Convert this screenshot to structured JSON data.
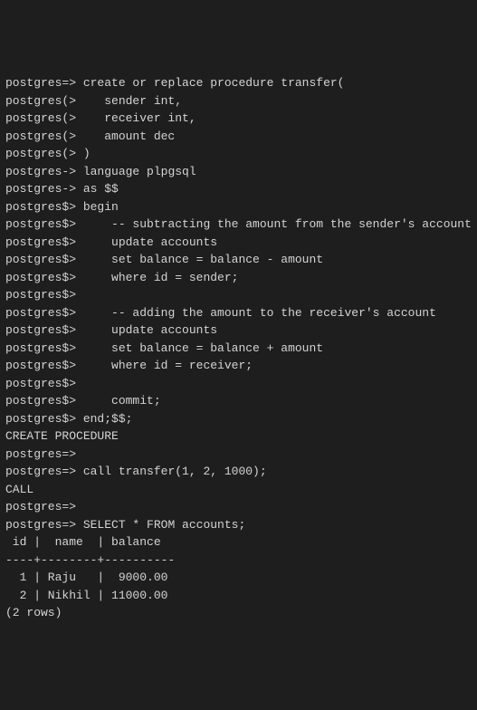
{
  "lines": [
    {
      "prompt": "postgres=> ",
      "text": "create or replace procedure transfer("
    },
    {
      "prompt": "postgres(>    ",
      "text": "sender int,"
    },
    {
      "prompt": "postgres(>    ",
      "text": "receiver int,"
    },
    {
      "prompt": "postgres(>    ",
      "text": "amount dec"
    },
    {
      "prompt": "postgres(> ",
      "text": ")"
    },
    {
      "prompt": "postgres-> ",
      "text": "language plpgsql"
    },
    {
      "prompt": "postgres-> ",
      "text": "as $$"
    },
    {
      "prompt": "postgres$> ",
      "text": "begin"
    },
    {
      "prompt": "postgres$>     ",
      "text": "-- subtracting the amount from the sender's account"
    },
    {
      "prompt": "postgres$>     ",
      "text": "update accounts"
    },
    {
      "prompt": "postgres$>     ",
      "text": "set balance = balance - amount"
    },
    {
      "prompt": "postgres$>     ",
      "text": "where id = sender;"
    },
    {
      "prompt": "postgres$>",
      "text": ""
    },
    {
      "prompt": "postgres$>     ",
      "text": "-- adding the amount to the receiver's account"
    },
    {
      "prompt": "postgres$>     ",
      "text": "update accounts"
    },
    {
      "prompt": "postgres$>     ",
      "text": "set balance = balance + amount"
    },
    {
      "prompt": "postgres$>     ",
      "text": "where id = receiver;"
    },
    {
      "prompt": "postgres$>",
      "text": ""
    },
    {
      "prompt": "postgres$>     ",
      "text": "commit;"
    },
    {
      "prompt": "postgres$> ",
      "text": "end;$$;"
    },
    {
      "prompt": "",
      "text": "CREATE PROCEDURE"
    },
    {
      "prompt": "postgres=>",
      "text": ""
    },
    {
      "prompt": "postgres=> ",
      "text": "call transfer(1, 2, 1000);"
    },
    {
      "prompt": "",
      "text": "CALL"
    },
    {
      "prompt": "postgres=>",
      "text": ""
    },
    {
      "prompt": "postgres=> ",
      "text": "SELECT * FROM accounts;"
    },
    {
      "prompt": "",
      "text": " id |  name  | balance"
    },
    {
      "prompt": "",
      "text": "----+--------+----------"
    },
    {
      "prompt": "",
      "text": "  1 | Raju   |  9000.00"
    },
    {
      "prompt": "",
      "text": "  2 | Nikhil | 11000.00"
    },
    {
      "prompt": "",
      "text": "(2 rows)"
    }
  ],
  "result_table": {
    "columns": [
      "id",
      "name",
      "balance"
    ],
    "rows": [
      {
        "id": 1,
        "name": "Raju",
        "balance": "9000.00"
      },
      {
        "id": 2,
        "name": "Nikhil",
        "balance": "11000.00"
      }
    ],
    "row_count_text": "(2 rows)"
  }
}
